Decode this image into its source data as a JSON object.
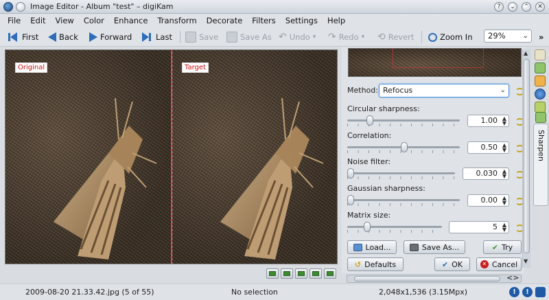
{
  "window": {
    "title": "Image Editor - Album \"test\" – digiKam"
  },
  "menubar": {
    "items": [
      "File",
      "Edit",
      "View",
      "Color",
      "Enhance",
      "Transform",
      "Decorate",
      "Filters",
      "Settings",
      "Help"
    ]
  },
  "toolbar": {
    "first": "First",
    "back": "Back",
    "forward": "Forward",
    "last": "Last",
    "save": "Save",
    "save_as": "Save As",
    "undo": "Undo",
    "redo": "Redo",
    "revert": "Revert",
    "zoom_in": "Zoom In",
    "zoom_value": "29%"
  },
  "canvas": {
    "original_label": "Original",
    "target_label": "Target"
  },
  "panel": {
    "method_label": "Method:",
    "method_value": "Refocus",
    "circular_label": "Circular sharpness:",
    "circular_value": "1.00",
    "correlation_label": "Correlation:",
    "correlation_value": "0.50",
    "noise_label": "Noise filter:",
    "noise_value": "0.030",
    "gaussian_label": "Gaussian sharpness:",
    "gaussian_value": "0.00",
    "matrix_label": "Matrix size:",
    "matrix_value": "5",
    "load_label": "Load...",
    "save_as_label": "Save As...",
    "try_label": "Try",
    "defaults_label": "Defaults",
    "ok_label": "OK",
    "cancel_label": "Cancel"
  },
  "sidebar": {
    "sharpen_tab": "Sharpen"
  },
  "statusbar": {
    "file_info": "2009-08-20 21.33.42.jpg (5 of 55)",
    "selection": "No selection",
    "dimensions": "2,048x1,536 (3.15Mpx)"
  },
  "colors": {
    "accent": "#2d6db8",
    "label_red": "#cc1010",
    "selection_red": "#ff3030"
  }
}
